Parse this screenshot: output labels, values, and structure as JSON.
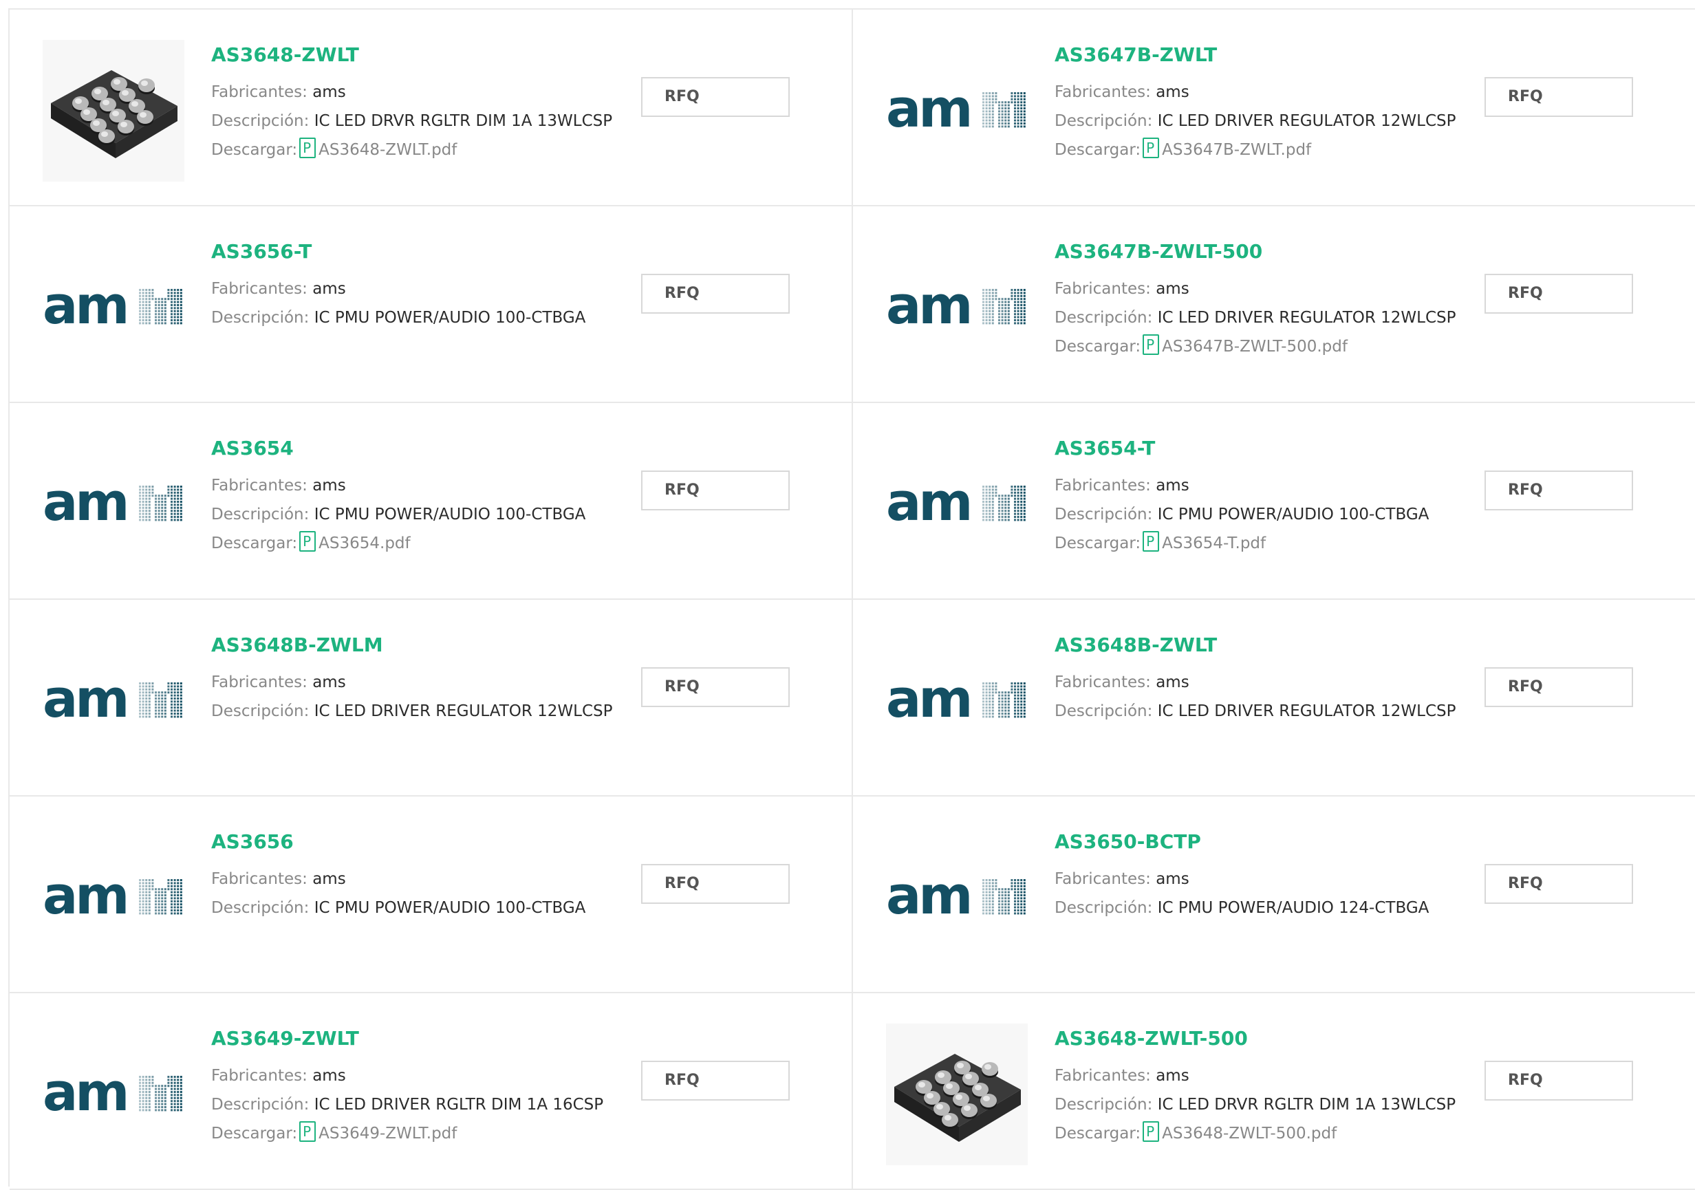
{
  "labels": {
    "manufacturer": "Fabricantes:",
    "description": "Descripción:",
    "download": "Descargar:",
    "rfq": "RFQ"
  },
  "colors": {
    "part_number": "#1db37f",
    "ams_logo_blue": "#144f63",
    "border": "#e8e8e8"
  },
  "products": [
    {
      "part": "AS3648-ZWLT",
      "manufacturer": "ams",
      "description": "IC LED DRVR RGLTR DIM 1A 13WLCSP",
      "pdf": "AS3648-ZWLT.pdf",
      "image": "chip-image"
    },
    {
      "part": "AS3647B-ZWLT",
      "manufacturer": "ams",
      "description": "IC LED DRIVER REGULATOR 12WLCSP",
      "pdf": "AS3647B-ZWLT.pdf",
      "image": "ams-logo"
    },
    {
      "part": "AS3656-T",
      "manufacturer": "ams",
      "description": "IC PMU POWER/AUDIO 100-CTBGA",
      "pdf": null,
      "image": "ams-logo"
    },
    {
      "part": "AS3647B-ZWLT-500",
      "manufacturer": "ams",
      "description": "IC LED DRIVER REGULATOR 12WLCSP",
      "pdf": "AS3647B-ZWLT-500.pdf",
      "image": "ams-logo"
    },
    {
      "part": "AS3654",
      "manufacturer": "ams",
      "description": "IC PMU POWER/AUDIO 100-CTBGA",
      "pdf": "AS3654.pdf",
      "image": "ams-logo"
    },
    {
      "part": "AS3654-T",
      "manufacturer": "ams",
      "description": "IC PMU POWER/AUDIO 100-CTBGA",
      "pdf": "AS3654-T.pdf",
      "image": "ams-logo"
    },
    {
      "part": "AS3648B-ZWLM",
      "manufacturer": "ams",
      "description": "IC LED DRIVER REGULATOR 12WLCSP",
      "pdf": null,
      "image": "ams-logo"
    },
    {
      "part": "AS3648B-ZWLT",
      "manufacturer": "ams",
      "description": "IC LED DRIVER REGULATOR 12WLCSP",
      "pdf": null,
      "image": "ams-logo"
    },
    {
      "part": "AS3656",
      "manufacturer": "ams",
      "description": "IC PMU POWER/AUDIO 100-CTBGA",
      "pdf": null,
      "image": "ams-logo"
    },
    {
      "part": "AS3650-BCTP",
      "manufacturer": "ams",
      "description": "IC PMU POWER/AUDIO 124-CTBGA",
      "pdf": null,
      "image": "ams-logo"
    },
    {
      "part": "AS3649-ZWLT",
      "manufacturer": "ams",
      "description": "IC LED DRIVER RGLTR DIM 1A 16CSP",
      "pdf": "AS3649-ZWLT.pdf",
      "image": "ams-logo"
    },
    {
      "part": "AS3648-ZWLT-500",
      "manufacturer": "ams",
      "description": "IC LED DRVR RGLTR DIM 1A 13WLCSP",
      "pdf": "AS3648-ZWLT-500.pdf",
      "image": "chip-image"
    }
  ]
}
